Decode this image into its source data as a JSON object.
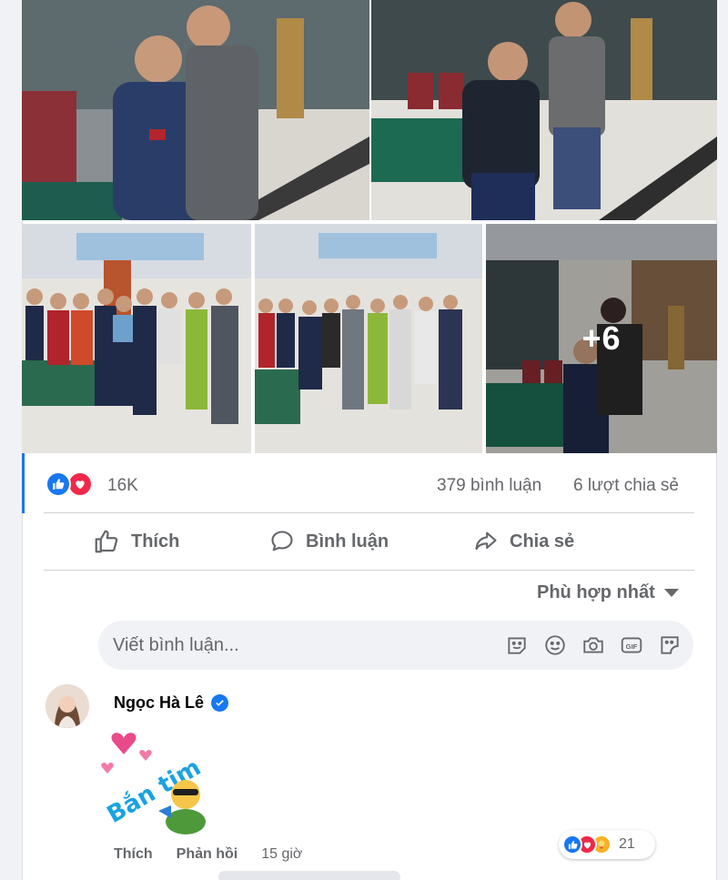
{
  "post": {
    "photos": [
      {
        "name": "photo-1",
        "scene": "two-men-lobby"
      },
      {
        "name": "photo-2",
        "scene": "men-by-table"
      },
      {
        "name": "photo-3",
        "scene": "group-photo"
      },
      {
        "name": "photo-4",
        "scene": "group-photo"
      },
      {
        "name": "photo-5",
        "scene": "more-photos"
      }
    ],
    "more_photos_label": "+6"
  },
  "reactions": {
    "count": "16K",
    "comments": "379 bình luận",
    "shares": "6 lượt chia sẻ",
    "icons": [
      "like-icon",
      "love-icon"
    ]
  },
  "actions": {
    "like_label": "Thích",
    "comment_label": "Bình luận",
    "share_label": "Chia sẻ"
  },
  "sort": {
    "label": "Phù hợp nhất"
  },
  "comment_box": {
    "placeholder": "Viết bình luận...",
    "icons": [
      "avatar-sticker-icon",
      "emoji-icon",
      "camera-icon",
      "gif-icon",
      "sticker-icon"
    ]
  },
  "comment": {
    "author": "Ngọc Hà Lê",
    "verified": true,
    "sticker_text": "Bắn tim",
    "like_label": "Thích",
    "reply_label": "Phản hồi",
    "time": "15 giờ",
    "reaction_count": "21",
    "reaction_icons": [
      "like-icon",
      "love-icon",
      "care-icon"
    ]
  },
  "colors": {
    "accent": "#1877f2",
    "love": "#f02849",
    "muted_text": "#65676b"
  }
}
